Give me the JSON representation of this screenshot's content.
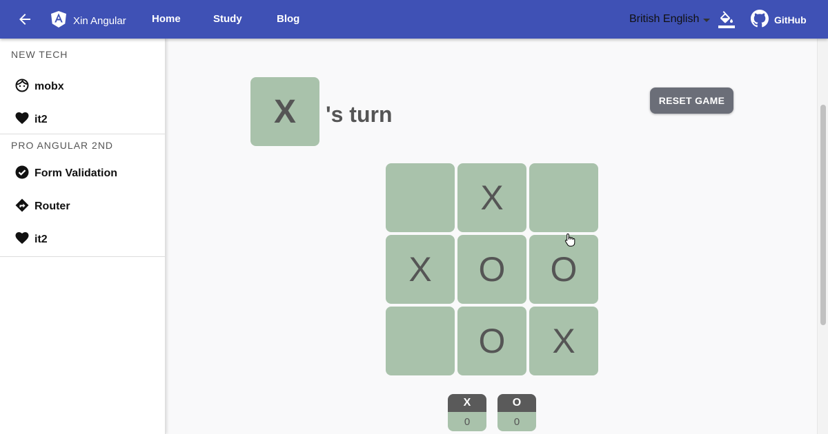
{
  "topbar": {
    "brand": "Xin Angular",
    "nav": [
      "Home",
      "Study",
      "Blog"
    ],
    "language": "British English",
    "github": "GitHub",
    "color": "#3f51b5"
  },
  "sidebar": {
    "sections": [
      {
        "title": "NEW TECH",
        "items": [
          {
            "label": "mobx",
            "icon": "face-icon"
          },
          {
            "label": "it2",
            "icon": "heart-icon"
          }
        ]
      },
      {
        "title": "PRO ANGULAR 2ND",
        "items": [
          {
            "label": "Form Validation",
            "icon": "check-circle-icon"
          },
          {
            "label": "Router",
            "icon": "directions-icon"
          },
          {
            "label": "it2",
            "icon": "heart-icon"
          }
        ]
      }
    ]
  },
  "game": {
    "current_player": "X",
    "turn_suffix": "'s turn",
    "reset_label": "RESET GAME",
    "board": [
      "",
      "X",
      "",
      "X",
      "O",
      "O",
      "",
      "O",
      "X"
    ],
    "cell_color": "#a9c2ab",
    "scores": [
      {
        "player": "X",
        "value": "0"
      },
      {
        "player": "O",
        "value": "0"
      }
    ]
  }
}
